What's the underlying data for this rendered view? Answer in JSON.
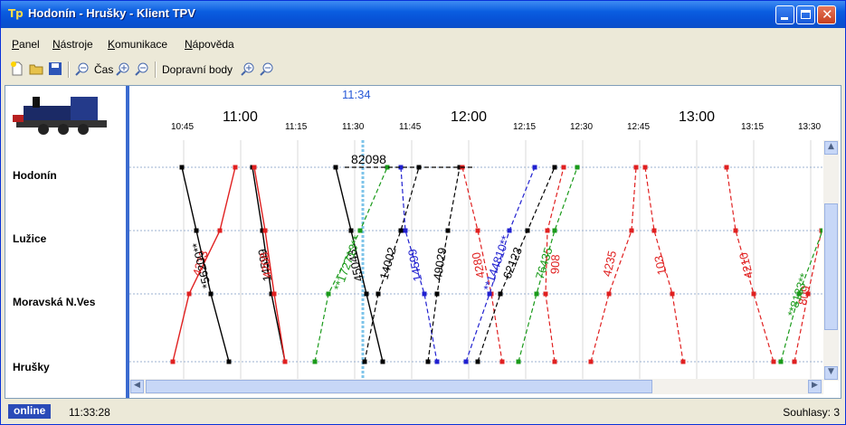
{
  "window": {
    "title": "Hodonín - Hrušky - Klient TPV",
    "icon": "Tp"
  },
  "menu": [
    {
      "label": "Panel",
      "underline": "P",
      "rest": "anel"
    },
    {
      "label": "Nástroje",
      "underline": "N",
      "rest": "ástroje"
    },
    {
      "label": "Komunikace",
      "underline": "K",
      "rest": "omunikace"
    },
    {
      "label": "Nápověda",
      "underline": "N",
      "rest": "ápověda"
    }
  ],
  "toolbar": {
    "time_label": "Čas",
    "points_label": "Dopravní body"
  },
  "stations": [
    "Hodonín",
    "Lužice",
    "Moravská N.Ves",
    "Hrušky"
  ],
  "timeline": {
    "current_time": "11:34",
    "ticks": [
      {
        "label": "10:45",
        "big": false
      },
      {
        "label": "11:00",
        "big": true
      },
      {
        "label": "11:15",
        "big": false
      },
      {
        "label": "11:30",
        "big": false
      },
      {
        "label": "11:45",
        "big": false
      },
      {
        "label": "12:00",
        "big": true
      },
      {
        "label": "12:15",
        "big": false
      },
      {
        "label": "12:30",
        "big": false
      },
      {
        "label": "12:45",
        "big": false
      },
      {
        "label": "13:00",
        "big": true
      },
      {
        "label": "13:15",
        "big": false
      },
      {
        "label": "13:30",
        "big": false
      }
    ]
  },
  "trains": [
    {
      "label": "4233",
      "color": "#e02020"
    },
    {
      "label": "*56200**",
      "color": "#000000"
    },
    {
      "label": "14599",
      "color": "#000000"
    },
    {
      "label": "4208",
      "color": "#e02020"
    },
    {
      "label": "45043",
      "color": "#000000"
    },
    {
      "label": "**172713**",
      "color": "#1a9a1a"
    },
    {
      "label": "14002",
      "color": "#000000"
    },
    {
      "label": "14599",
      "color": "#2020d0"
    },
    {
      "label": "49029",
      "color": "#000000"
    },
    {
      "label": "82098",
      "color": "#000000"
    },
    {
      "label": "4280",
      "color": "#e02020"
    },
    {
      "label": "**144810**",
      "color": "#2020d0"
    },
    {
      "label": "62123",
      "color": "#000000"
    },
    {
      "label": "76435",
      "color": "#1a9a1a"
    },
    {
      "label": "908",
      "color": "#e02020"
    },
    {
      "label": "4235",
      "color": "#e02020"
    },
    {
      "label": "103",
      "color": "#e02020"
    },
    {
      "label": "4210",
      "color": "#e02020"
    },
    {
      "label": "809",
      "color": "#e02020"
    },
    {
      "label": "**8133**",
      "color": "#1a9a1a"
    }
  ],
  "status": {
    "online": "online",
    "time": "11:33:28",
    "agreements": "Souhlasy: 3"
  }
}
